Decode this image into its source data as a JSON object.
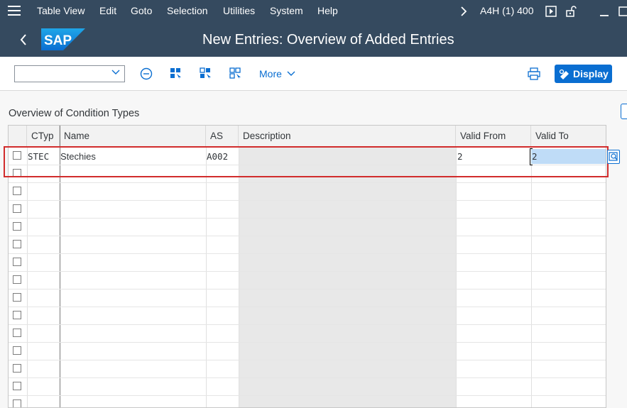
{
  "menubar": {
    "items": [
      {
        "label": "Table View"
      },
      {
        "label": "Edit"
      },
      {
        "label": "Goto"
      },
      {
        "label": "Selection"
      },
      {
        "label": "Utilities"
      },
      {
        "label": "System"
      },
      {
        "label": "Help"
      }
    ],
    "system_id": "A4H (1) 400"
  },
  "header": {
    "title": "New Entries: Overview of Added Entries",
    "logo_text": "SAP"
  },
  "toolbar": {
    "dropdown_value": "",
    "more_label": "More",
    "display_label": "Display"
  },
  "section": {
    "title": "Overview of Condition Types"
  },
  "table": {
    "columns": [
      "CTyp",
      "Name",
      "AS",
      "Description",
      "Valid From",
      "Valid To"
    ],
    "rows": [
      {
        "ctyp": "STEC",
        "name": "Stechies",
        "as": "A002",
        "description": "",
        "valid_from": "2",
        "valid_to": "2"
      }
    ],
    "empty_row_count": 14
  },
  "colors": {
    "shell": "#354a5f",
    "accent": "#0a6ed1",
    "highlight": "#d12c2c",
    "selection": "#bfdcf7"
  }
}
